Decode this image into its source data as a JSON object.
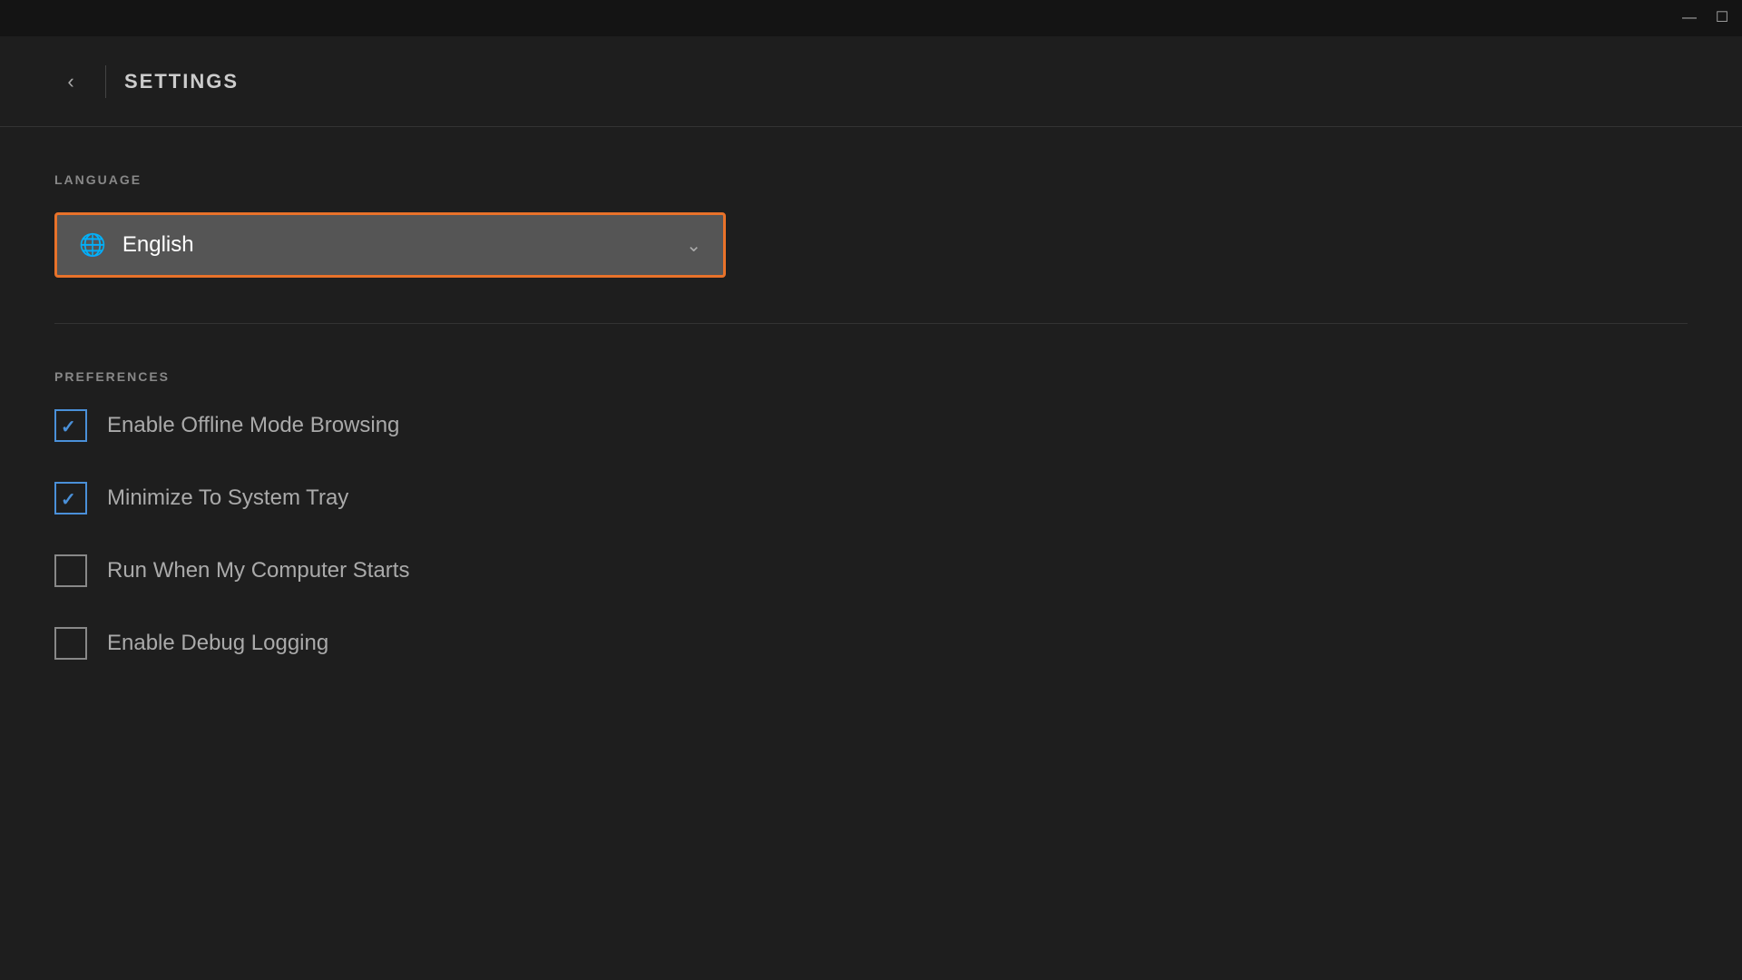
{
  "titlebar": {
    "minimize_label": "—",
    "maximize_label": "☐"
  },
  "header": {
    "back_label": "‹",
    "title": "SETTINGS"
  },
  "language_section": {
    "label": "LANGUAGE",
    "dropdown": {
      "selected": "English",
      "icon": "🌐"
    }
  },
  "preferences_section": {
    "label": "PREFERENCES",
    "items": [
      {
        "id": "offline-mode",
        "label": "Enable Offline Mode Browsing",
        "checked": true
      },
      {
        "id": "minimize-tray",
        "label": "Minimize To System Tray",
        "checked": true
      },
      {
        "id": "run-on-start",
        "label": "Run When My Computer Starts",
        "checked": false
      },
      {
        "id": "debug-logging",
        "label": "Enable Debug Logging",
        "checked": false
      }
    ]
  }
}
